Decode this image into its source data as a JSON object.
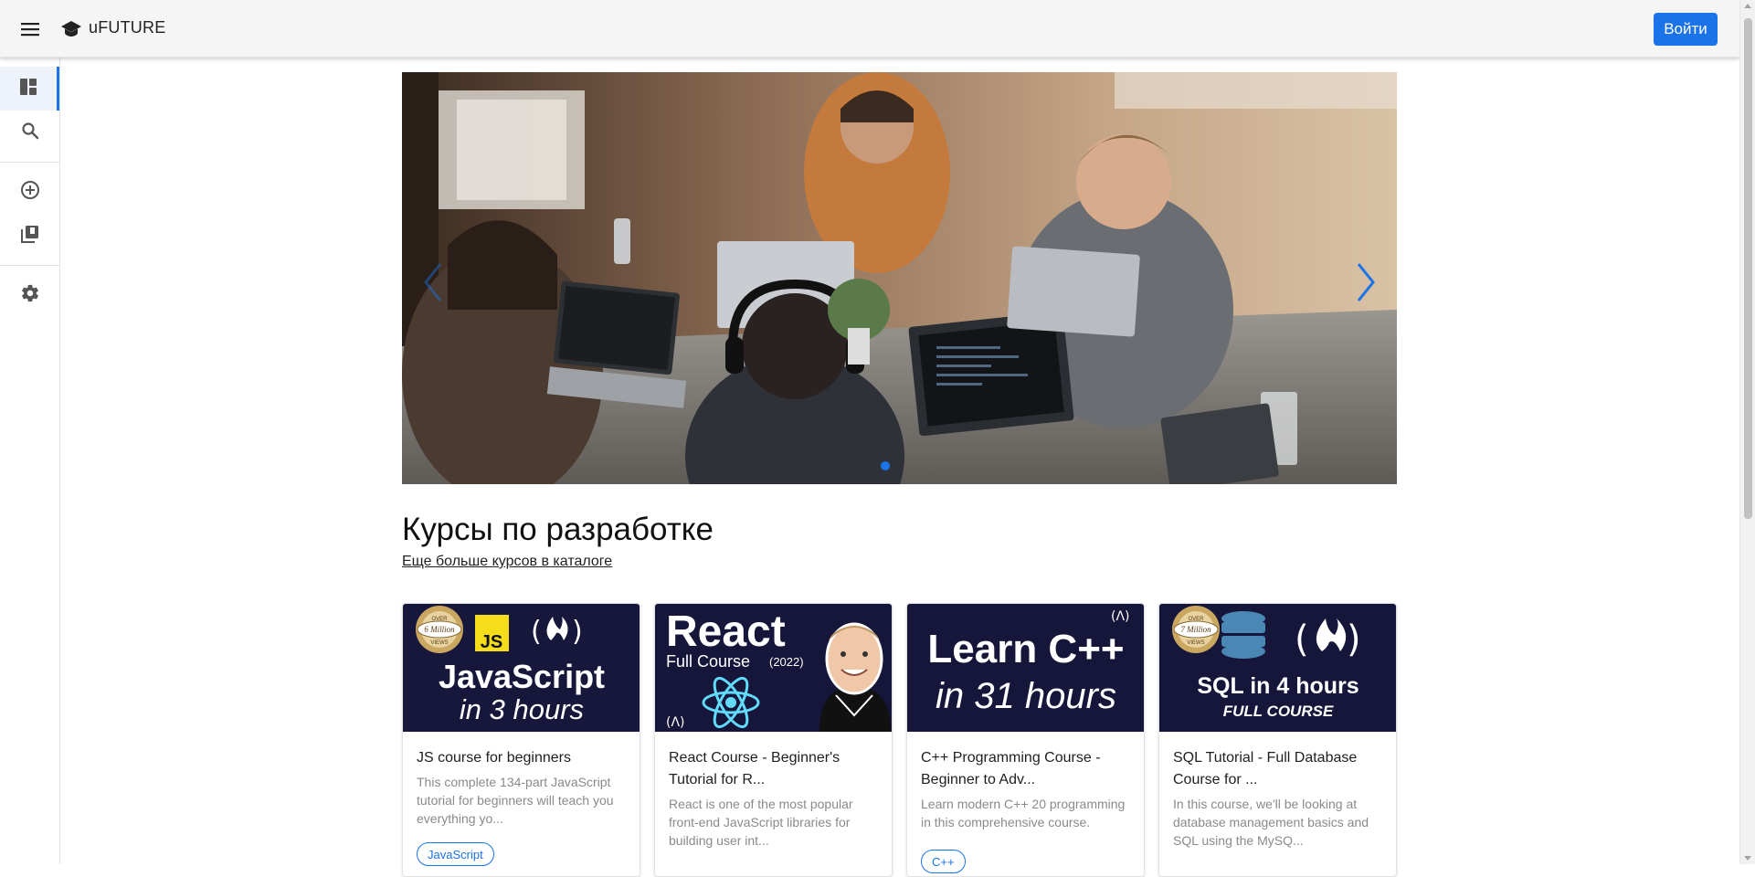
{
  "app": {
    "brand": "uFUTURE",
    "login_label": "Войти"
  },
  "icons": {
    "menu": "menu-icon",
    "logo": "graduation-cap-icon",
    "sidebar": [
      "dashboard-icon",
      "search-icon",
      "add-circle-icon",
      "library-icon",
      "settings-icon"
    ],
    "carousel_prev": "chevron-left-icon",
    "carousel_next": "chevron-right-icon"
  },
  "colors": {
    "accent": "#1a73e8",
    "appbar_bg": "#f5f5f5",
    "thumb_dark": "#15163a"
  },
  "section": {
    "title": "Курсы по разработке",
    "link": "Еще больше курсов в каталоге"
  },
  "courses": [
    {
      "title": "JS course for beginners",
      "description": "This complete 134-part JavaScript tutorial for beginners will teach you everything yo...",
      "tag": "JavaScript",
      "thumb": {
        "badge_top": "OVER",
        "badge_mid": "6 Million",
        "badge_bot": "VIEWS",
        "logo": "JS",
        "line1": "JavaScript",
        "line2": "in 3 hours"
      }
    },
    {
      "title": "React Course - Beginner's Tutorial for R...",
      "description": "React is one of the most popular front-end JavaScript libraries for building user int...",
      "tag": "",
      "thumb": {
        "line1": "React",
        "line2": "Full Course",
        "year": "(2022)"
      }
    },
    {
      "title": "C++ Programming Course - Beginner to Adv...",
      "description": "Learn modern C++ 20 programming in this comprehensive course.",
      "tag": "C++",
      "thumb": {
        "line1": "Learn C++",
        "line2": "in 31 hours"
      }
    },
    {
      "title": "SQL Tutorial - Full Database Course for ...",
      "description": "In this course, we'll be looking at database management basics and SQL using the MySQ...",
      "tag": "",
      "thumb": {
        "badge_top": "OVER",
        "badge_mid": "7 Million",
        "badge_bot": "VIEWS",
        "line1": "SQL in 4 hours",
        "line2": "FULL COURSE"
      }
    }
  ]
}
